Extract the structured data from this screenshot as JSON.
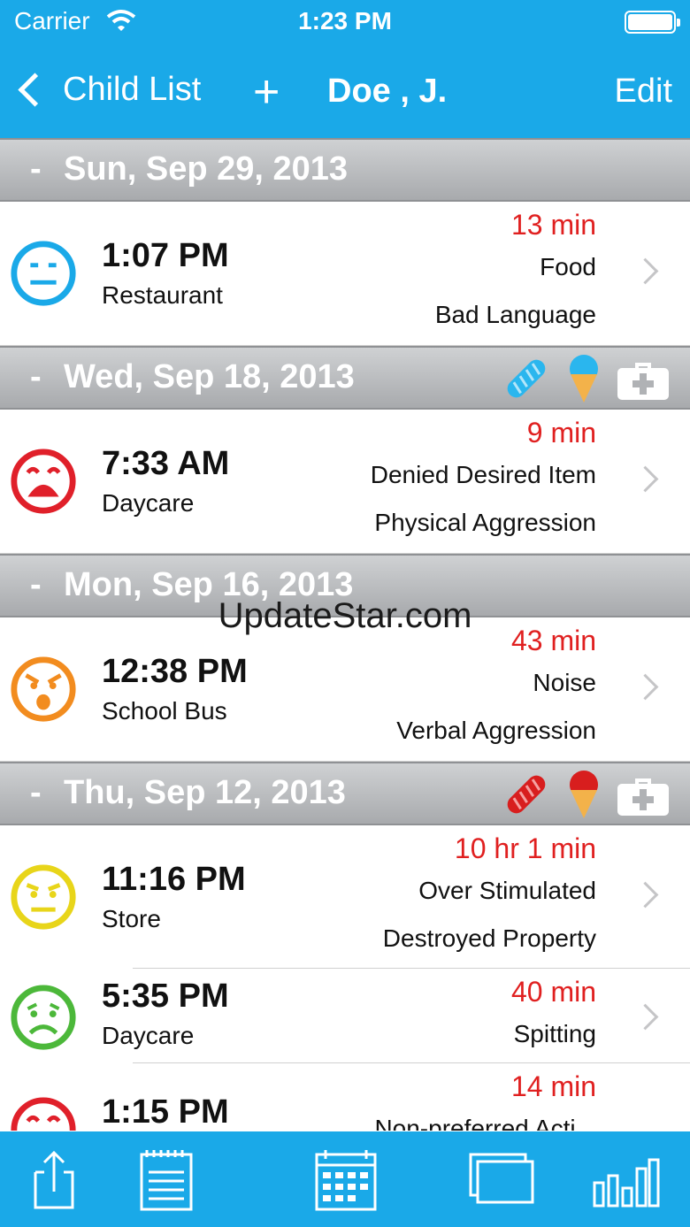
{
  "status_bar": {
    "carrier": "Carrier",
    "time": "1:23 PM"
  },
  "nav": {
    "back_label": "Child List",
    "add_label": "+",
    "title": "Doe , J.",
    "edit_label": "Edit"
  },
  "sections": [
    {
      "date": "Sun, Sep 29, 2013",
      "icons": [],
      "entries": [
        {
          "face": "neutral-blue",
          "time": "1:07 PM",
          "place": "Restaurant",
          "duration": "13 min",
          "line1": "Food",
          "line2": "Bad Language"
        }
      ]
    },
    {
      "date": "Wed, Sep 18, 2013",
      "icons": [
        "bread-blue-icon",
        "icecream-blue-icon",
        "medkit-icon"
      ],
      "entries": [
        {
          "face": "crying-red",
          "time": "7:33 AM",
          "place": "Daycare",
          "duration": "9 min",
          "line1": "Denied Desired Item",
          "line2": "Physical Aggression"
        }
      ]
    },
    {
      "date": "Mon, Sep 16, 2013",
      "icons": [],
      "entries": [
        {
          "face": "angry-orange",
          "time": "12:38 PM",
          "place": "School Bus",
          "duration": "43 min",
          "line1": "Noise",
          "line2": "Verbal Aggression"
        }
      ]
    },
    {
      "date": "Thu, Sep 12, 2013",
      "icons": [
        "bread-red-icon",
        "icecream-red-icon",
        "medkit-icon"
      ],
      "entries": [
        {
          "face": "annoyed-yellow",
          "time": "11:16 PM",
          "place": "Store",
          "duration": "10 hr 1 min",
          "line1": "Over Stimulated",
          "line2": "Destroyed Property"
        },
        {
          "face": "sad-green",
          "time": "5:35 PM",
          "place": "Daycare",
          "duration": "40 min",
          "line1": "Spitting",
          "line2": ""
        },
        {
          "face": "crying-red",
          "time": "1:15 PM",
          "place": "",
          "duration": "14 min",
          "line1": "Non-preferred Acti...",
          "line2": ""
        }
      ]
    }
  ],
  "watermark": "UpdateStar.com",
  "tabs": [
    "share-icon",
    "notes-icon",
    "calendar-icon",
    "windows-icon",
    "chart-icon"
  ],
  "colors": {
    "accent": "#1aa9e8",
    "duration": "#e02020",
    "blue": "#1aa9e8",
    "red": "#e0202a",
    "orange": "#f28c1f",
    "yellow": "#e8d51a",
    "green": "#4cb83a"
  }
}
